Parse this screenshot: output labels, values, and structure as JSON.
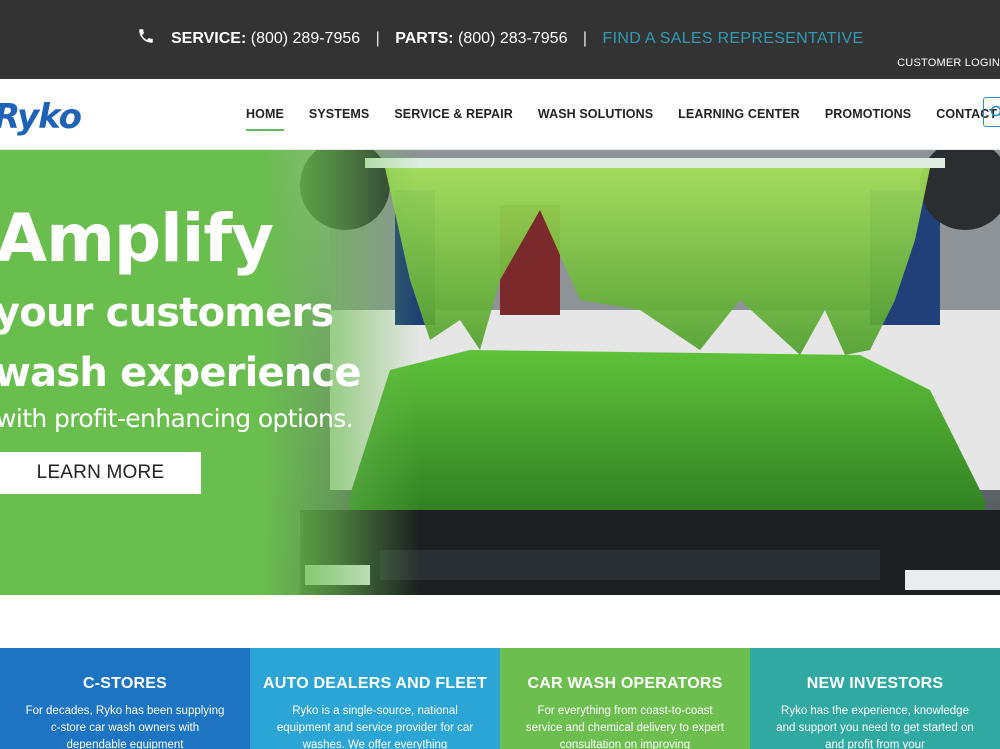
{
  "topbar": {
    "service_label": "SERVICE:",
    "service_phone": "(800) 289-7956",
    "separator": "|",
    "parts_label": "PARTS:",
    "parts_phone": "(800) 283-7956",
    "sales_link": "FIND A SALES REPRESENTATIVE",
    "customer_login": "CUSTOMER LOGIN"
  },
  "brand": {
    "logo_text": "Ryko",
    "color": "#1f63b8"
  },
  "nav": {
    "items": [
      {
        "label": "HOME",
        "active": true
      },
      {
        "label": "SYSTEMS"
      },
      {
        "label": "SERVICE & REPAIR"
      },
      {
        "label": "WASH SOLUTIONS"
      },
      {
        "label": "LEARNING CENTER"
      },
      {
        "label": "PROMOTIONS"
      },
      {
        "label": "CONTACT US"
      }
    ],
    "search_icon": "search-icon"
  },
  "hero": {
    "headline": "Amplify",
    "line1": "your customers",
    "line2": "wash experience",
    "subline": "with profit-enhancing options.",
    "cta_label": "LEARN MORE",
    "accent": "#6abe4e"
  },
  "cards": [
    {
      "title": "C-STORES",
      "text": "For decades, Ryko has been supplying c-store car wash owners with dependable equipment",
      "color": "#1c74c2"
    },
    {
      "title": "AUTO DEALERS AND FLEET",
      "text": "Ryko is a single-source, national equipment and service provider for car washes. We offer everything",
      "color": "#2ba4d6"
    },
    {
      "title": "CAR WASH OPERATORS",
      "text": "For everything from coast-to-coast service and chemical delivery to expert consultation on improving",
      "color": "#6cbf4f"
    },
    {
      "title": "NEW INVESTORS",
      "text": "Ryko has the experience, knowledge and support you need to get started on and profit from your",
      "color": "#2fa9a2"
    }
  ]
}
